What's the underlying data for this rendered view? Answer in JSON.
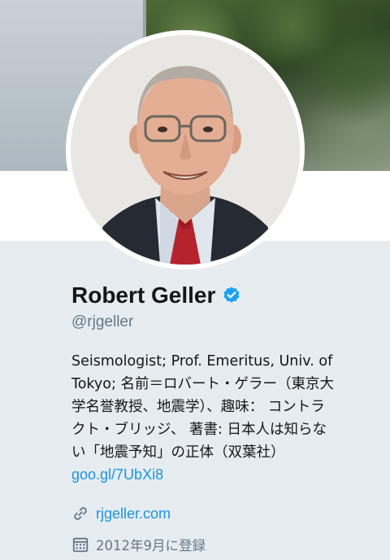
{
  "profile": {
    "name": "Robert Geller",
    "handle": "@rjgeller",
    "verified": true,
    "bio_lines": [
      "Seismologist; Prof. Emeritus, Univ. of",
      "Tokyo; 名前＝ロバート・ゲラー（東京大",
      "学名誉教授、地震学）、趣味： コントラ",
      "クト・ブリッジ、 著書: 日本人は知らな",
      "い「地震予知」の正体（双葉社）"
    ],
    "bio_link": "goo.gl/7UbXi8",
    "website": "rjgeller.com",
    "joined": "2012年9月に登録"
  },
  "icons": {
    "verified": "verified-badge-icon",
    "website": "link-icon",
    "joined": "calendar-icon"
  },
  "colors": {
    "background": "#e6ecf0",
    "link": "#1b95e0",
    "verified": "#1da1f2",
    "muted": "#657786",
    "text": "#14171a"
  }
}
